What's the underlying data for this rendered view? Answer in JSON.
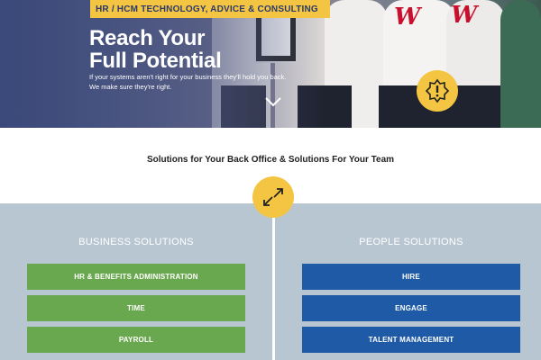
{
  "hero": {
    "tag": "HR / HCM TECHNOLOGY, ADVICE & CONSULTING",
    "title_line1": "Reach Your",
    "title_line2": "Full Potential",
    "subtitle_line1": "If your systems aren't right for your business they'll hold you back.",
    "subtitle_line2": "We make sure they're right.",
    "scroll_icon": "chevron-down-icon",
    "badge_icon": "warning-burst-icon"
  },
  "section": {
    "heading": "Solutions for Your Back Office & Solutions For Your Team",
    "badge_icon": "swap-arrows-icon"
  },
  "business": {
    "title": "BUSINESS SOLUTIONS",
    "items": [
      "HR & BENEFITS ADMINISTRATION",
      "TIME",
      "PAYROLL"
    ]
  },
  "people": {
    "title": "PEOPLE SOLUTIONS",
    "items": [
      "HIRE",
      "ENGAGE",
      "TALENT MANAGEMENT"
    ]
  },
  "colors": {
    "accent_yellow": "#f4c542",
    "business_green": "#6aa84f",
    "people_blue": "#1f5aa6",
    "section_bg": "#b8c6d2"
  }
}
